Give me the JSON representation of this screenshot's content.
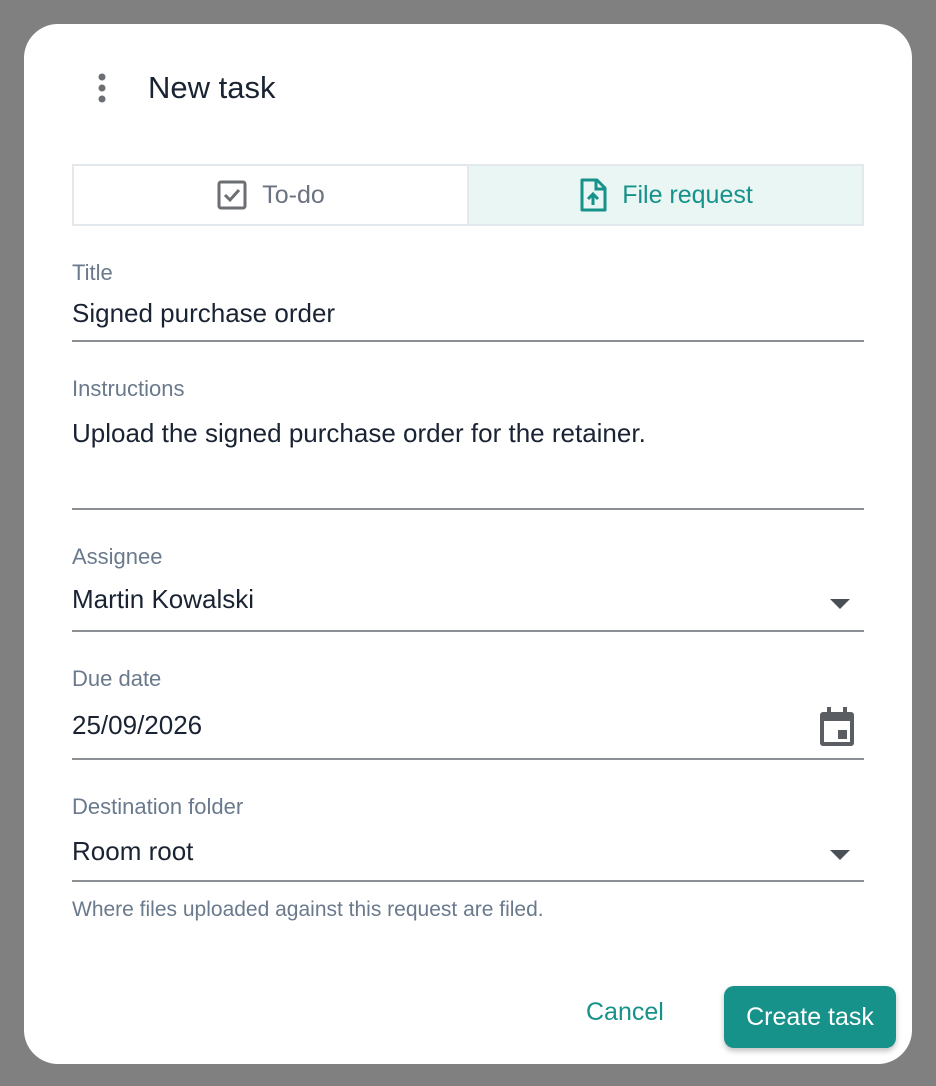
{
  "dialog": {
    "title": "New task",
    "menu_icon": "more-vert-icon"
  },
  "task_type": {
    "options": [
      {
        "label": "To-do",
        "icon": "checkbox-icon",
        "selected": false
      },
      {
        "label": "File request",
        "icon": "file-upload-icon",
        "selected": true
      }
    ]
  },
  "form": {
    "title": {
      "label": "Title",
      "value": "Signed purchase order"
    },
    "instructions": {
      "label": "Instructions",
      "value": "Upload the signed purchase order for the retainer."
    },
    "assignee": {
      "label": "Assignee",
      "value": "Martin Kowalski"
    },
    "due_date": {
      "label": "Due date",
      "value": "25/09/2026",
      "icon": "calendar-icon"
    },
    "destination": {
      "label": "Destination folder",
      "value": "Room root",
      "helper": "Where files uploaded against this request are filed."
    }
  },
  "actions": {
    "cancel_label": "Cancel",
    "create_label": "Create task"
  },
  "colors": {
    "accent": "#16928a",
    "selected_segment_bg": "#eaf6f4",
    "overlay": "#808080"
  }
}
